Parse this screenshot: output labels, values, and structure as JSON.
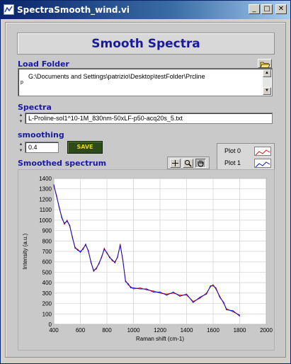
{
  "window": {
    "title": "SpectraSmooth_wind.vi",
    "minimize_glyph": "_",
    "maximize_glyph": "□",
    "close_glyph": "✕"
  },
  "header": {
    "title": "Smooth Spectra"
  },
  "load_folder": {
    "label": "Load Folder",
    "path": "G:\\Documents and Settings\\patrizio\\Desktop\\testFolder\\Prcline",
    "path_glyph": "p",
    "browse_icon": "folder-icon"
  },
  "spectra": {
    "label": "Spectra",
    "value": "L-Proline-sol1^10-1M_830nm-50xLF-p50-acq20s_5.txt"
  },
  "smoothing": {
    "label": "smoothing",
    "value": "0.4",
    "save_label": "SAVE"
  },
  "graph": {
    "label": "Smoothed spectrum",
    "palette_icons": [
      "crosshair-icon",
      "zoom-icon",
      "hand-icon"
    ],
    "legend": [
      {
        "name": "Plot 0",
        "color": "#e01010"
      },
      {
        "name": "Plot 1",
        "color": "#1010c0"
      }
    ]
  },
  "chart_data": {
    "type": "line",
    "xlabel": "Raman shift (cm-1)",
    "ylabel": "Intensity (a.u.)",
    "xlim": [
      400,
      2000
    ],
    "ylim": [
      0,
      1400
    ],
    "x_ticks": [
      "400",
      "600",
      "800",
      "1000",
      "1200",
      "1400",
      "1600",
      "1800",
      "2000"
    ],
    "y_ticks": [
      "0",
      "100",
      "200",
      "300",
      "400",
      "500",
      "600",
      "700",
      "800",
      "900",
      "1000",
      "1100",
      "1200",
      "1300",
      "1400"
    ],
    "grid": true,
    "series": [
      {
        "name": "Plot 0",
        "color": "#e01010",
        "x": [
          400,
          420,
          440,
          460,
          480,
          500,
          520,
          540,
          560,
          580,
          600,
          620,
          640,
          660,
          680,
          700,
          720,
          740,
          760,
          780,
          800,
          820,
          840,
          860,
          880,
          900,
          920,
          940,
          960,
          980,
          1000,
          1050,
          1100,
          1150,
          1200,
          1250,
          1300,
          1350,
          1400,
          1450,
          1500,
          1550,
          1580,
          1600,
          1620,
          1650,
          1680,
          1700,
          1750,
          1800
        ],
        "y": [
          1330,
          1240,
          1120,
          1030,
          960,
          1000,
          940,
          840,
          730,
          720,
          690,
          730,
          760,
          710,
          590,
          520,
          530,
          590,
          640,
          730,
          680,
          650,
          610,
          600,
          640,
          770,
          610,
          420,
          380,
          360,
          340,
          350,
          330,
          320,
          300,
          290,
          300,
          280,
          280,
          220,
          250,
          300,
          360,
          380,
          340,
          270,
          200,
          150,
          120,
          90
        ]
      },
      {
        "name": "Plot 1",
        "color": "#1010c0",
        "x": [
          400,
          420,
          440,
          460,
          480,
          500,
          520,
          540,
          560,
          580,
          600,
          620,
          640,
          660,
          680,
          700,
          720,
          740,
          760,
          780,
          800,
          820,
          840,
          860,
          880,
          900,
          920,
          940,
          960,
          980,
          1000,
          1050,
          1100,
          1150,
          1200,
          1250,
          1300,
          1350,
          1400,
          1450,
          1500,
          1550,
          1580,
          1600,
          1620,
          1650,
          1680,
          1700,
          1750,
          1800
        ],
        "y": [
          1340,
          1230,
          1130,
          1020,
          970,
          990,
          950,
          830,
          740,
          710,
          700,
          720,
          770,
          700,
          600,
          510,
          540,
          580,
          650,
          720,
          690,
          640,
          620,
          590,
          650,
          760,
          620,
          410,
          390,
          350,
          350,
          340,
          340,
          310,
          310,
          280,
          310,
          270,
          290,
          210,
          260,
          290,
          370,
          370,
          350,
          260,
          210,
          140,
          130,
          80
        ]
      }
    ]
  }
}
